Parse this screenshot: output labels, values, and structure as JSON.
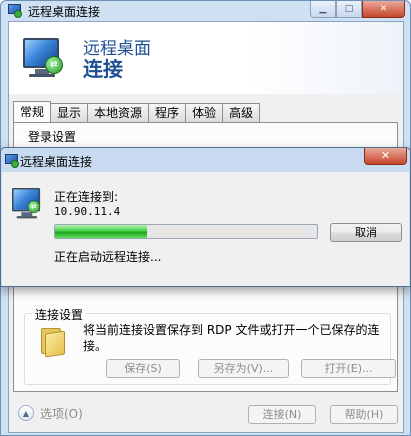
{
  "main_window": {
    "title": "远程桌面连接",
    "banner_line1": "远程桌面",
    "banner_line2": "连接",
    "tabs": [
      {
        "label": "常规",
        "active": true
      },
      {
        "label": "显示",
        "active": false
      },
      {
        "label": "本地资源",
        "active": false
      },
      {
        "label": "程序",
        "active": false
      },
      {
        "label": "体验",
        "active": false
      },
      {
        "label": "高级",
        "active": false
      }
    ],
    "login_settings_label": "登录设置",
    "connection_settings": {
      "title": "连接设置",
      "description": "将当前连接设置保存到 RDP 文件或打开一个已保存的连接。",
      "save_label": "保存(S)",
      "save_as_label": "另存为(V)...",
      "open_label": "打开(E)..."
    },
    "options_label": "选项(O)",
    "connect_label": "连接(N)",
    "help_label": "帮助(H)"
  },
  "dialog": {
    "title": "远程桌面连接",
    "connecting_to_label": "正在连接到:",
    "ip_address": "10.90.11.4",
    "progress_percent": 35,
    "cancel_label": "取消",
    "status": "正在启动远程连接..."
  },
  "icons": {
    "app": "remote-desktop-icon",
    "minimize": "minimize-icon",
    "maximize": "maximize-icon",
    "close": "close-icon",
    "folder": "folder-icon",
    "options_toggle": "chevron-up-icon"
  }
}
